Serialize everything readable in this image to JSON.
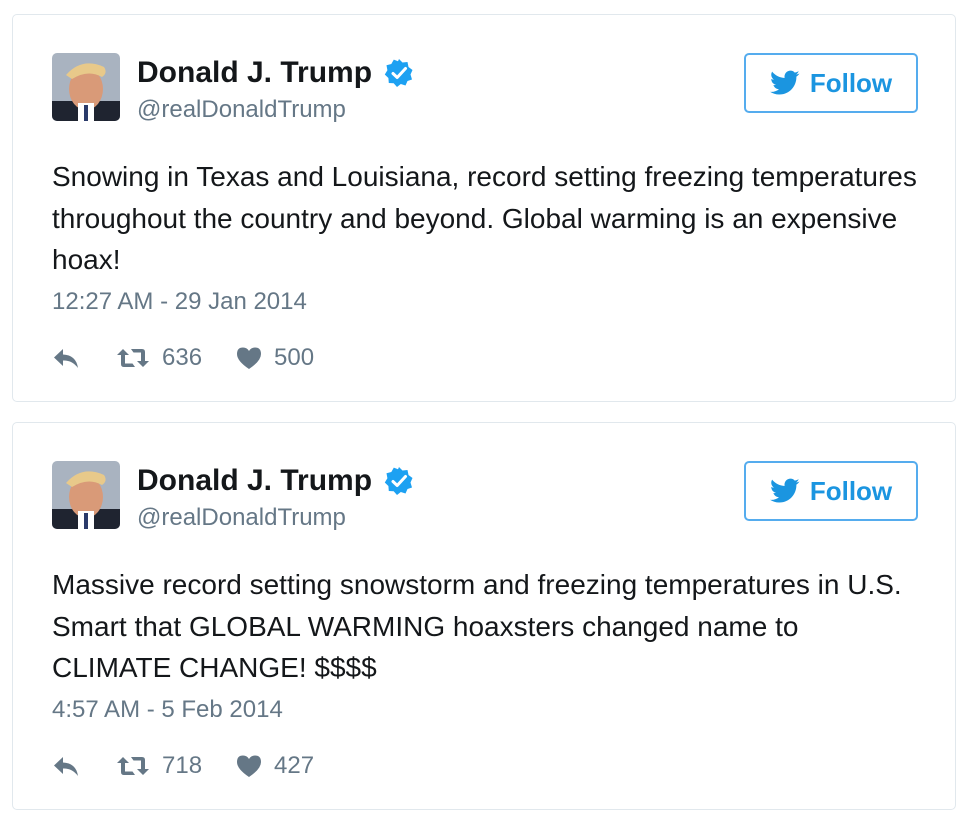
{
  "tweets": [
    {
      "author": {
        "name": "Donald J. Trump",
        "handle": "@realDonaldTrump",
        "verified": true
      },
      "follow_label": "Follow",
      "text": "Snowing in Texas and Louisiana, record setting freezing temperatures throughout the country and beyond. Global warming is an expensive hoax!",
      "timestamp": "12:27 AM - 29 Jan 2014",
      "retweets": "636",
      "likes": "500"
    },
    {
      "author": {
        "name": "Donald J. Trump",
        "handle": "@realDonaldTrump",
        "verified": true
      },
      "follow_label": "Follow",
      "text": "Massive record setting snowstorm and freezing temperatures in U.S. Smart that GLOBAL WARMING hoaxsters changed name to CLIMATE CHANGE! $$$$",
      "timestamp": "4:57 AM - 5 Feb 2014",
      "retweets": "718",
      "likes": "427"
    }
  ],
  "icons": {
    "reply": "reply-icon",
    "retweet": "retweet-icon",
    "like": "heart-icon",
    "verified": "verified-badge-icon",
    "follow": "twitter-bird-icon"
  },
  "colors": {
    "accent": "#1b95e0",
    "follow_border": "#55acee",
    "verified": "#1da1f2",
    "text": "#14171a",
    "secondary": "#657786",
    "border": "#e1e8ed"
  }
}
